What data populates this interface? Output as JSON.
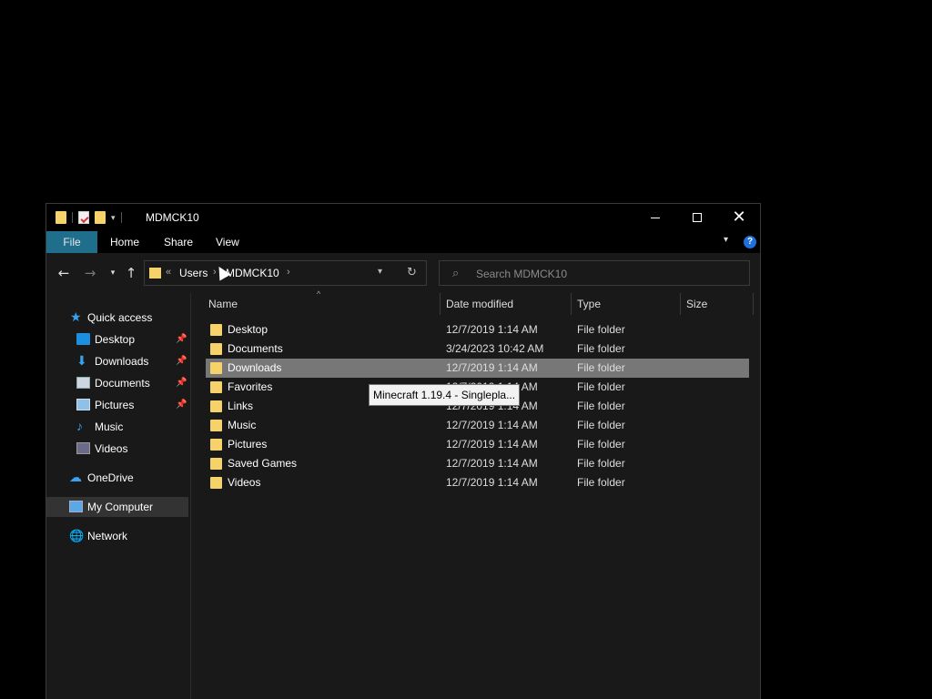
{
  "window": {
    "title": "MDMCK10",
    "controls": {
      "minimize": "minimize",
      "maximize": "maximize",
      "close": "✕"
    }
  },
  "ribbon": {
    "tabs": [
      "File",
      "Home",
      "Share",
      "View"
    ],
    "help": "?"
  },
  "nav": {
    "breadcrumb": [
      "Users",
      "MDMCK10"
    ],
    "search_placeholder": "Search MDMCK10"
  },
  "sidebar": {
    "items": [
      {
        "label": "Quick access",
        "icon": "star-icon"
      },
      {
        "label": "Desktop",
        "icon": "desktop-icon",
        "pinned": true
      },
      {
        "label": "Downloads",
        "icon": "download-icon",
        "pinned": true
      },
      {
        "label": "Documents",
        "icon": "documents-icon",
        "pinned": true
      },
      {
        "label": "Pictures",
        "icon": "pictures-icon",
        "pinned": true
      },
      {
        "label": "Music",
        "icon": "music-icon"
      },
      {
        "label": "Videos",
        "icon": "videos-icon"
      },
      {
        "label": "OneDrive",
        "icon": "cloud-icon"
      },
      {
        "label": "My Computer",
        "icon": "computer-icon",
        "selected": true
      },
      {
        "label": "Network",
        "icon": "network-icon"
      }
    ]
  },
  "columns": [
    "Name",
    "Date modified",
    "Type",
    "Size"
  ],
  "files": [
    {
      "name": "Desktop",
      "date": "12/7/2019 1:14 AM",
      "type": "File folder"
    },
    {
      "name": "Documents",
      "date": "3/24/2023 10:42 AM",
      "type": "File folder"
    },
    {
      "name": "Downloads",
      "date": "12/7/2019 1:14 AM",
      "type": "File folder",
      "selected": true
    },
    {
      "name": "Favorites",
      "date": "12/7/2019 1:14 AM",
      "type": "File folder"
    },
    {
      "name": "Links",
      "date": "12/7/2019 1:14 AM",
      "type": "File folder"
    },
    {
      "name": "Music",
      "date": "12/7/2019 1:14 AM",
      "type": "File folder"
    },
    {
      "name": "Pictures",
      "date": "12/7/2019 1:14 AM",
      "type": "File folder"
    },
    {
      "name": "Saved Games",
      "date": "12/7/2019 1:14 AM",
      "type": "File folder"
    },
    {
      "name": "Videos",
      "date": "12/7/2019 1:14 AM",
      "type": "File folder"
    }
  ],
  "tooltip": "Minecraft 1.19.4 - Singlepla..."
}
